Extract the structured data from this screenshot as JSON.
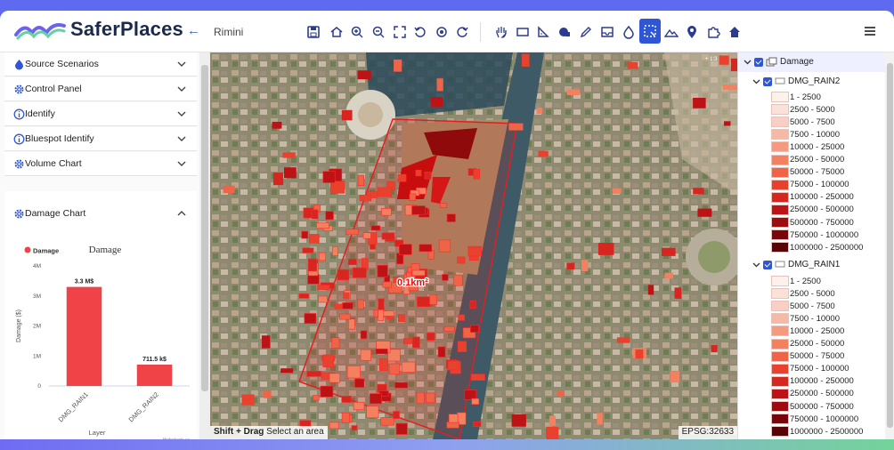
{
  "app": {
    "brand": "SaferPlaces",
    "location": "Rimini",
    "back_icon": "arrow-left-icon",
    "menu_icon": "hamburger-icon"
  },
  "toolbar": [
    {
      "name": "save-icon"
    },
    {
      "name": "home-icon"
    },
    {
      "name": "zoom-in-icon"
    },
    {
      "name": "zoom-out-icon"
    },
    {
      "name": "fullscreen-icon"
    },
    {
      "name": "rotate-left-icon"
    },
    {
      "name": "target-icon"
    },
    {
      "name": "rotate-right-icon"
    },
    {
      "name": "pan-hand-icon"
    },
    {
      "name": "rectangle-icon"
    },
    {
      "name": "ruler-icon"
    },
    {
      "name": "draw-shape-icon"
    },
    {
      "name": "pencil-icon"
    },
    {
      "name": "inbox-icon"
    },
    {
      "name": "drop-icon"
    },
    {
      "name": "select-area-icon",
      "active": true
    },
    {
      "name": "terrain-icon"
    },
    {
      "name": "pin-icon"
    },
    {
      "name": "puzzle-icon"
    },
    {
      "name": "house-icon"
    }
  ],
  "sidebar": {
    "sections": [
      {
        "label": "Source Scenarios",
        "icon": "drop-icon"
      },
      {
        "label": "Control Panel",
        "icon": "gear-icon"
      },
      {
        "label": "Identify",
        "icon": "info-icon"
      },
      {
        "label": "Bluespot Identify",
        "icon": "info-icon"
      },
      {
        "label": "Volume Chart",
        "icon": "gear-icon"
      }
    ],
    "expanded": {
      "label": "Damage Chart",
      "icon": "gear-icon"
    }
  },
  "chart_data": {
    "type": "bar",
    "title": "Damage",
    "legend": "Damage",
    "categories": [
      "DMG_RAIN1",
      "DMG_RAIN2"
    ],
    "values": [
      3.3,
      0.7115
    ],
    "data_labels": [
      "3.3 M$",
      "711.5 k$"
    ],
    "ylabel": "Damage ($)",
    "xlabel": "Layer",
    "ylim": [
      0,
      4
    ],
    "yticks": [
      "0",
      "1M",
      "2M",
      "3M",
      "4M"
    ],
    "credits": "Highcharts.cc",
    "color": "#f04347"
  },
  "map": {
    "measure_label": "0.1km²",
    "hint_bold": "Shift + Drag",
    "hint_text": " Select an area",
    "crs": "EPSG:32633",
    "scale": "+ 1:3"
  },
  "layers": {
    "root": "Damage",
    "groups": [
      {
        "name": "DMG_RAIN2"
      },
      {
        "name": "DMG_RAIN1"
      }
    ],
    "legend": [
      {
        "label": "1 - 2500",
        "color": "#fdf1ec"
      },
      {
        "label": "2500 - 5000",
        "color": "#fbe2d9"
      },
      {
        "label": "5000 - 7500",
        "color": "#f8cfc2"
      },
      {
        "label": "7500 - 10000",
        "color": "#f6b9a5"
      },
      {
        "label": "10000 - 25000",
        "color": "#f59a7e"
      },
      {
        "label": "25000 - 50000",
        "color": "#f3805f"
      },
      {
        "label": "50000 - 75000",
        "color": "#ef6446"
      },
      {
        "label": "75000 - 100000",
        "color": "#e8412d"
      },
      {
        "label": "100000 - 250000",
        "color": "#d72520"
      },
      {
        "label": "250000 - 500000",
        "color": "#bd1316"
      },
      {
        "label": "500000 - 750000",
        "color": "#9d0a10"
      },
      {
        "label": "750000 - 1000000",
        "color": "#7a040b"
      },
      {
        "label": "1000000 - 2500000",
        "color": "#590207"
      }
    ]
  }
}
